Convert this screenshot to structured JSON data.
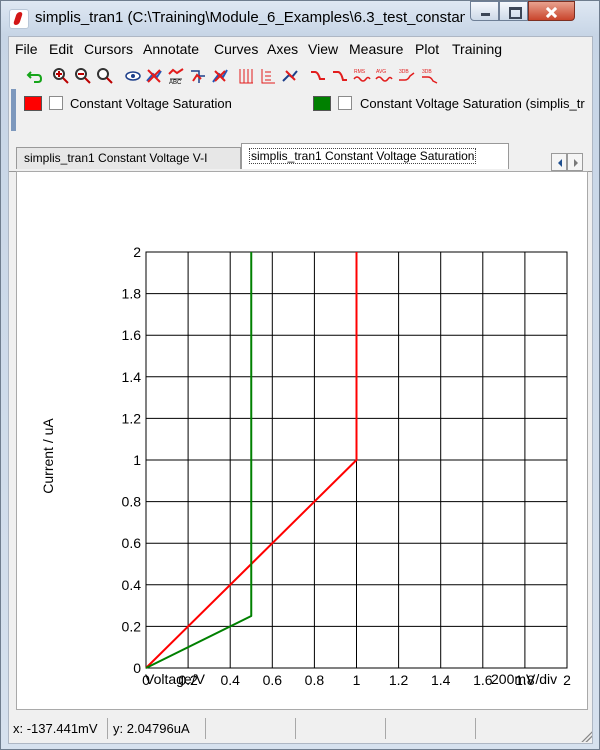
{
  "window": {
    "title": "simplis_tran1 (C:\\Training\\Module_6_Examples\\6.3_test_constan…"
  },
  "menu": {
    "items": [
      "File",
      "Edit",
      "Cursors",
      "Annotate",
      "Curves",
      "Axes",
      "View",
      "Measure",
      "Plot",
      "Training"
    ]
  },
  "toolbar": {
    "icons": [
      "undo-icon",
      "zoom-in-icon",
      "zoom-out-icon",
      "zoom-fit-icon",
      "eye-icon",
      "delete-curve-icon",
      "rename-curve-icon",
      "move-curve-icon",
      "delete-curve-alt-icon",
      "grid-icon",
      "ticks-icon",
      "properties-icon",
      "curve-arith-icon",
      "curve-derivative-icon",
      "rms-icon",
      "avg-icon",
      "3db-icon",
      "3db-alt-icon"
    ],
    "labels": {
      "rms": "RMS",
      "avg": "AVG",
      "3db": "3DB",
      "3db_alt": "3DB"
    }
  },
  "legend": {
    "items": [
      {
        "label": "Constant Voltage Saturation",
        "color": "#ff0000"
      },
      {
        "label": "Constant Voltage Saturation (simplis_tr",
        "color": "#008000"
      }
    ]
  },
  "tabs": [
    {
      "label": "simplis_tran1 Constant Voltage V-I",
      "active": false
    },
    {
      "label": "simplis_tran1 Constant Voltage Saturation",
      "active": true
    }
  ],
  "chart_data": {
    "type": "line",
    "title": "",
    "xlabel": "Voltage/V",
    "ylabel": "Current / uA",
    "scale_note": "200mV/div",
    "xlim": [
      0,
      2
    ],
    "ylim": [
      0,
      2
    ],
    "x_ticks": [
      "0",
      "0.2",
      "0.4",
      "0.6",
      "0.8",
      "1",
      "1.2",
      "1.4",
      "1.6",
      "1.8",
      "2"
    ],
    "y_ticks": [
      "0",
      "0.2",
      "0.4",
      "0.6",
      "0.8",
      "1",
      "1.2",
      "1.4",
      "1.6",
      "1.8",
      "2"
    ],
    "grid": true,
    "series": [
      {
        "name": "Constant Voltage Saturation",
        "color": "#ff0000",
        "points": [
          [
            0,
            0
          ],
          [
            1,
            1
          ],
          [
            1,
            2
          ]
        ]
      },
      {
        "name": "Constant Voltage Saturation (simplis_tr",
        "color": "#008000",
        "points": [
          [
            0,
            0
          ],
          [
            0.5,
            0.25
          ],
          [
            0.5,
            2
          ]
        ]
      }
    ]
  },
  "status": {
    "x": "x: -137.441mV",
    "y": "y: 2.04796uA"
  }
}
